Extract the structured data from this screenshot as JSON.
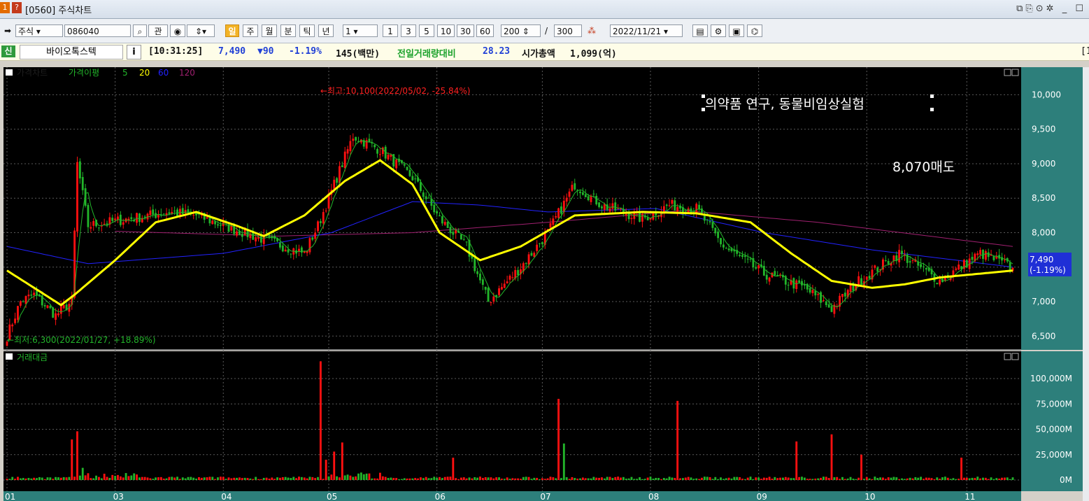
{
  "window": {
    "title": "[0560] 주식차트",
    "badge1": "1",
    "badge2": "?"
  },
  "toolbar": {
    "market": "주식",
    "code": "086040",
    "gwan": "관",
    "periods": [
      "일",
      "주",
      "월",
      "분",
      "틱",
      "년"
    ],
    "unit": "1",
    "intervals": [
      "1",
      "3",
      "5",
      "10",
      "30",
      "60"
    ],
    "count": "200",
    "total": "300",
    "date": "2022/11/21"
  },
  "info": {
    "new_badge": "신",
    "name": "바이오톡스텍",
    "info_btn": "i",
    "time": "[10:31:25]",
    "price": "7,490",
    "change": "▼90",
    "change_pct": "-1.19%",
    "volume": "145(백만)",
    "vol_ratio_label": "전일거래량대비",
    "vol_ratio": "28.23",
    "mcap_label": "시가총액",
    "mcap": "1,099(억)",
    "right_edge": "[1"
  },
  "chart_data": [
    {
      "type": "candlestick",
      "title": "가격차트",
      "legend": [
        "가격이평",
        "5",
        "20",
        "60",
        "120"
      ],
      "colors": {
        "up": "#ff1010",
        "down": "#22b52a",
        "ma5": "#22b52a",
        "ma20": "#ffff00",
        "ma60": "#2222ff",
        "ma120": "#a02070"
      },
      "ylim": [
        6300,
        10400
      ],
      "yticks": [
        6500,
        7000,
        7500,
        8000,
        8500,
        9000,
        9500,
        10000
      ],
      "ytick_labels": [
        "6,500",
        "7,000",
        "7,500",
        "8,000",
        "8,500",
        "9,000",
        "9,500",
        "10,000"
      ],
      "x_month_labels": [
        "01",
        "03",
        "04",
        "05",
        "06",
        "07",
        "08",
        "09",
        "10",
        "11"
      ],
      "annotations": {
        "high": "←최고:10,100(2022/05/02, -25.84%)",
        "low": "←최저:6,300(2022/01/27, +18.89%)",
        "note1": "의약품 연구, 동물비임상실험",
        "note2": "8,070매도",
        "last_price": "7,490",
        "last_pct": "(-1.19%)"
      },
      "ma20_keypoints": [
        [
          0,
          7450
        ],
        [
          12,
          7150
        ],
        [
          20,
          6950
        ],
        [
          25,
          7100
        ],
        [
          40,
          7600
        ],
        [
          55,
          8150
        ],
        [
          60,
          8200
        ],
        [
          70,
          8300
        ],
        [
          85,
          8100
        ],
        [
          95,
          7950
        ],
        [
          110,
          8250
        ],
        [
          125,
          8750
        ],
        [
          138,
          9050
        ],
        [
          150,
          8700
        ],
        [
          160,
          8000
        ],
        [
          175,
          7600
        ],
        [
          190,
          7800
        ],
        [
          210,
          8250
        ],
        [
          235,
          8300
        ],
        [
          255,
          8280
        ],
        [
          275,
          8150
        ],
        [
          290,
          7700
        ],
        [
          305,
          7300
        ],
        [
          320,
          7200
        ],
        [
          332,
          7250
        ],
        [
          345,
          7350
        ],
        [
          372,
          7450
        ]
      ],
      "ma60_keypoints": [
        [
          0,
          7800
        ],
        [
          30,
          7550
        ],
        [
          80,
          7700
        ],
        [
          120,
          8000
        ],
        [
          150,
          8450
        ],
        [
          175,
          8400
        ],
        [
          200,
          8300
        ],
        [
          240,
          8350
        ],
        [
          280,
          8000
        ],
        [
          320,
          7750
        ],
        [
          372,
          7500
        ]
      ],
      "ma120_keypoints": [
        [
          40,
          8020
        ],
        [
          100,
          7950
        ],
        [
          150,
          8000
        ],
        [
          200,
          8150
        ],
        [
          250,
          8320
        ],
        [
          300,
          8150
        ],
        [
          372,
          7800
        ]
      ],
      "anchors": [
        [
          0,
          6500
        ],
        [
          5,
          7000
        ],
        [
          10,
          7100
        ],
        [
          18,
          6800
        ],
        [
          24,
          7000
        ],
        [
          26,
          9000
        ],
        [
          30,
          8100
        ],
        [
          45,
          8200
        ],
        [
          60,
          8300
        ],
        [
          70,
          8250
        ],
        [
          80,
          8100
        ],
        [
          95,
          7900
        ],
        [
          110,
          7700
        ],
        [
          115,
          8100
        ],
        [
          120,
          8600
        ],
        [
          128,
          9400
        ],
        [
          138,
          9200
        ],
        [
          150,
          8800
        ],
        [
          160,
          8200
        ],
        [
          170,
          7800
        ],
        [
          178,
          7000
        ],
        [
          190,
          7500
        ],
        [
          200,
          8000
        ],
        [
          210,
          8700
        ],
        [
          220,
          8400
        ],
        [
          235,
          8200
        ],
        [
          245,
          8400
        ],
        [
          255,
          8350
        ],
        [
          265,
          7800
        ],
        [
          280,
          7400
        ],
        [
          295,
          7200
        ],
        [
          305,
          6900
        ],
        [
          315,
          7300
        ],
        [
          330,
          7700
        ],
        [
          345,
          7300
        ],
        [
          360,
          7700
        ],
        [
          372,
          7490
        ]
      ]
    },
    {
      "type": "bar",
      "title": "거래대금",
      "ylim": [
        0,
        120000
      ],
      "yticks": [
        0,
        25000,
        50000,
        75000,
        100000
      ],
      "ytick_labels": [
        "0M",
        "25,000M",
        "50,000M",
        "75,000M",
        "100,000M"
      ],
      "spikes": [
        [
          24,
          40000,
          "up"
        ],
        [
          26,
          48000,
          "up"
        ],
        [
          28,
          12000,
          "down"
        ],
        [
          116,
          117000,
          "up"
        ],
        [
          118,
          20000,
          "up"
        ],
        [
          121,
          28000,
          "up"
        ],
        [
          124,
          37000,
          "up"
        ],
        [
          165,
          22000,
          "up"
        ],
        [
          204,
          80000,
          "up"
        ],
        [
          206,
          36000,
          "down"
        ],
        [
          248,
          78000,
          "up"
        ],
        [
          292,
          38000,
          "up"
        ],
        [
          305,
          45000,
          "up"
        ],
        [
          316,
          25000,
          "up"
        ],
        [
          353,
          22000,
          "up"
        ]
      ]
    }
  ]
}
